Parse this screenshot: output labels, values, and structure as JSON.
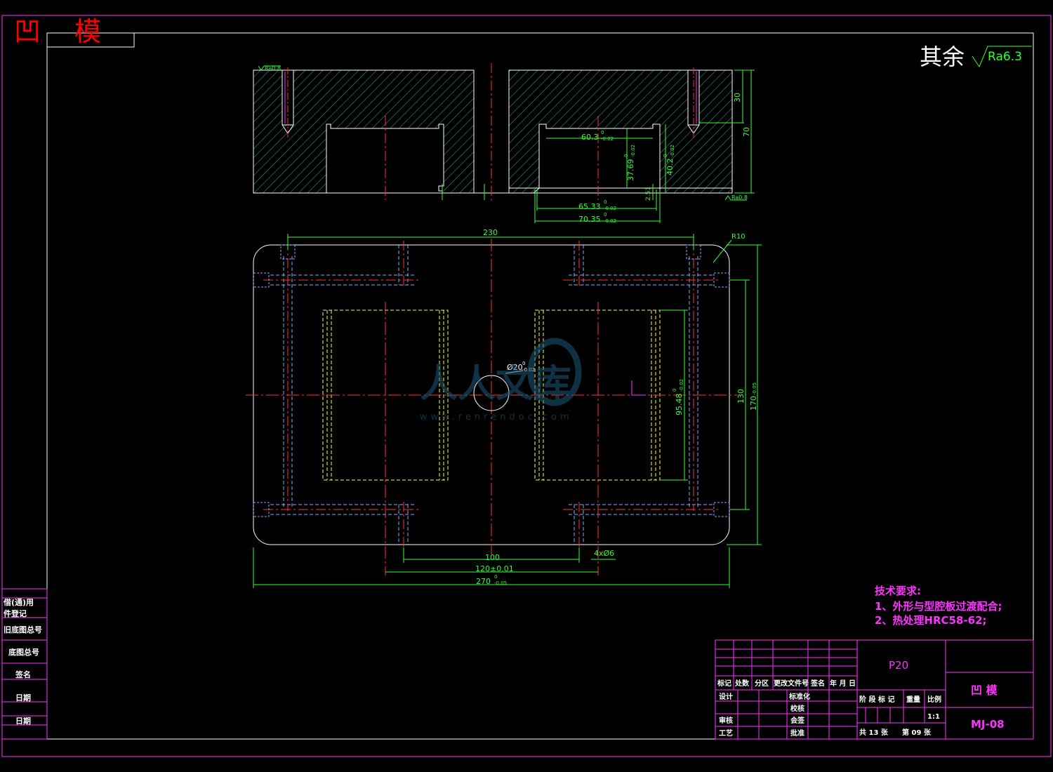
{
  "title": {
    "part1": "凹",
    "part2": "模"
  },
  "roughness": {
    "prefix": "其余",
    "value": "Ra6.3"
  },
  "roughness_small": {
    "a": "Ra0.8",
    "b": "Ra0.8"
  },
  "section_dims": {
    "d1": "60.3",
    "d1_tol": "0",
    "d1_tol2": "-0.02",
    "d2": "37.69",
    "d2_tol": "0",
    "d2_tol2": "-0.02",
    "d3": "40.2",
    "d3_tol": "0",
    "d3_tol2": "-0.02",
    "d4": "65.33",
    "d4_tol": "0",
    "d4_tol2": "-0.02",
    "d5": "70.35",
    "d5_tol": "0",
    "d5_tol2": "-0.02",
    "d6": "2.51",
    "d7": "30",
    "d8": "70"
  },
  "plan_dims": {
    "width_inner": "230",
    "r": "R10",
    "hole": "Ø20",
    "hole_tol": "0",
    "hole_tol2": "-0.02",
    "cav_h": "95.48",
    "cav_h_tol": "0",
    "cav_h_tol2": "-0.02",
    "h130": "130",
    "h170": "170",
    "h170_tol": "-0.05",
    "w100": "100",
    "w120": "120±0.01",
    "w270": "270",
    "w270_tol": "0",
    "w270_tol2": "-0.05",
    "holes": "4xØ6"
  },
  "watermark": {
    "main": "人人文库",
    "url": "www.renrendoc.com"
  },
  "tech_req": {
    "heading": "技术要求:",
    "line1": "1、外形与型腔板过渡配合;",
    "line2": "2、热处理HRC58-62;"
  },
  "side_table": [
    "借(通)用",
    "件登记",
    "旧底图总号",
    "底图总号",
    "签名",
    "日期",
    "日期"
  ],
  "title_block": {
    "material": "P20",
    "part_name": "凹  模",
    "drawing_no": "MJ-08",
    "h_mark": "标记",
    "h_qty": "处数",
    "h_zone": "分区",
    "h_doc": "更改文件号",
    "h_sign": "签名",
    "h_date": "年 月 日",
    "design": "设计",
    "standard": "标准化",
    "check": "审核",
    "process": "工艺",
    "proofread": "校核",
    "sign2": "会签",
    "approve": "批准",
    "stage_mark": "阶 段 标 记",
    "weight": "重量",
    "scale_label": "比例",
    "scale": "1:1",
    "sheets_total": "共 13 张",
    "sheet_no": "第 09 张"
  }
}
